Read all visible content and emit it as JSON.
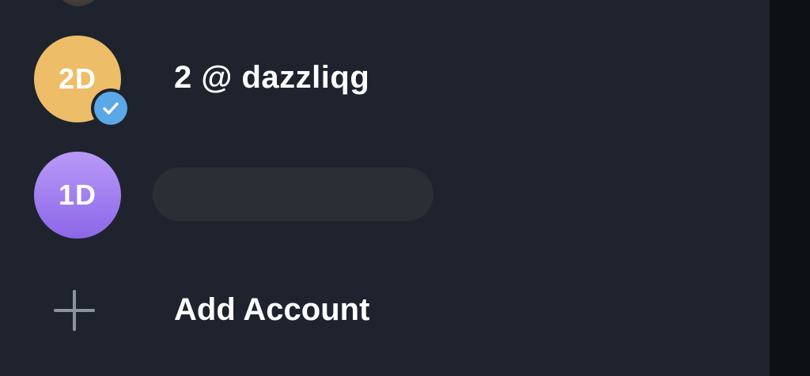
{
  "accounts": [
    {
      "initials": "2D",
      "name": "2 @ dazzliqg",
      "avatar_color": "#eebd68",
      "verified": true,
      "badge_icon": "check-icon",
      "badge_color": "#5aa8e8"
    },
    {
      "initials": "1D",
      "name": "",
      "avatar_color": "#9b7cf0",
      "verified": false
    }
  ],
  "add_account": {
    "label": "Add Account",
    "icon": "plus-icon"
  },
  "colors": {
    "drawer_bg": "#1e232e",
    "scrim": "#0e1114",
    "text": "#ffffff",
    "icon_muted": "#8a949e"
  }
}
